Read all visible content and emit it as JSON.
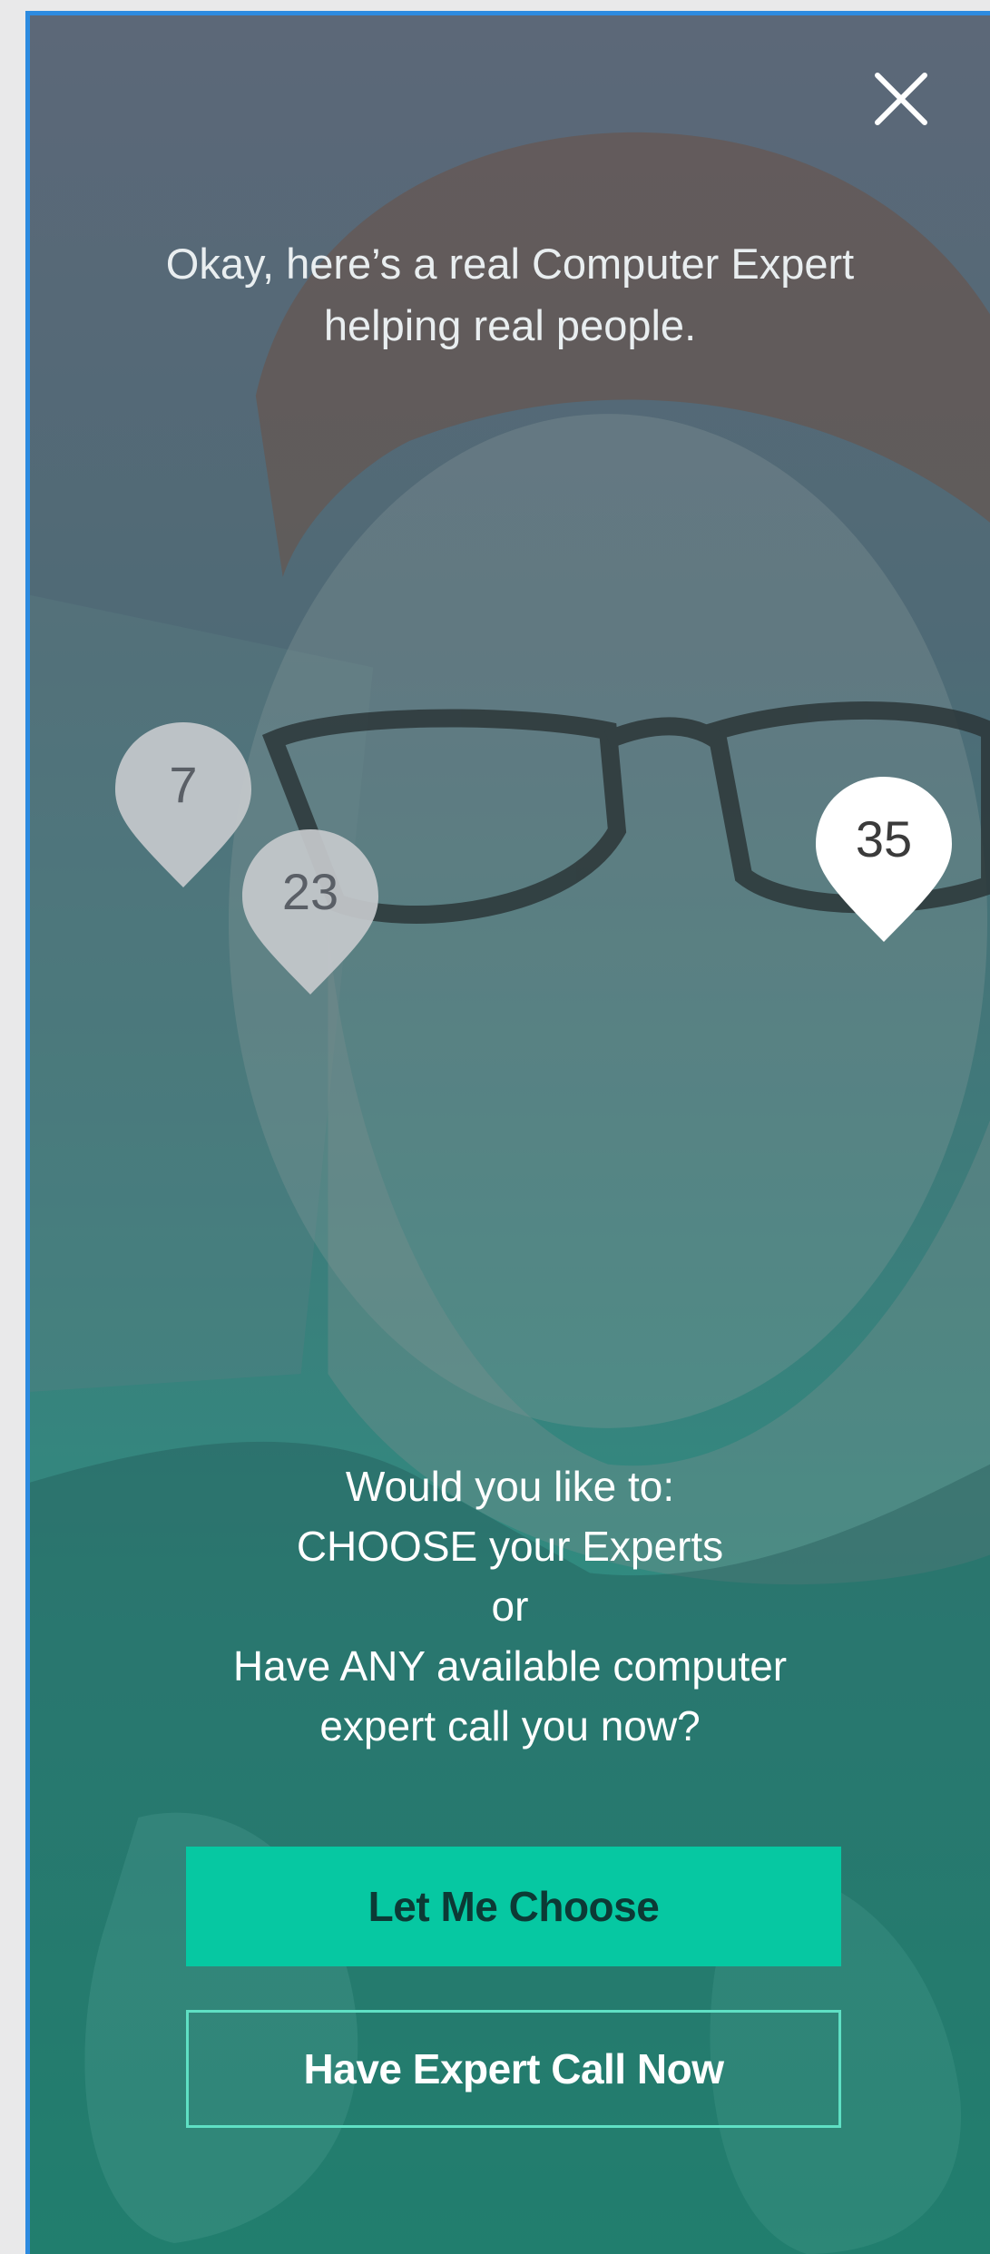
{
  "modal": {
    "intro_line1": "Okay, here’s a real Computer Expert",
    "intro_line2": "helping real people."
  },
  "pins": [
    {
      "number": "7",
      "state": "dim"
    },
    {
      "number": "23",
      "state": "dim"
    },
    {
      "number": "35",
      "state": "active"
    }
  ],
  "question": {
    "line1": "Would you like to:",
    "line2": "CHOOSE your Experts",
    "line3": "or",
    "line4": "Have ANY available computer",
    "line5": "expert call you now?"
  },
  "actions": {
    "primary_label": "Let Me Choose",
    "secondary_label": "Have Expert Call Now"
  },
  "colors": {
    "accent": "#06c8a2",
    "frame_border": "#2d8be0",
    "pin_dim": "#c5c9cc",
    "pin_active": "#ffffff"
  },
  "icons": {
    "close": "close-icon",
    "pin": "map-pin-icon"
  }
}
